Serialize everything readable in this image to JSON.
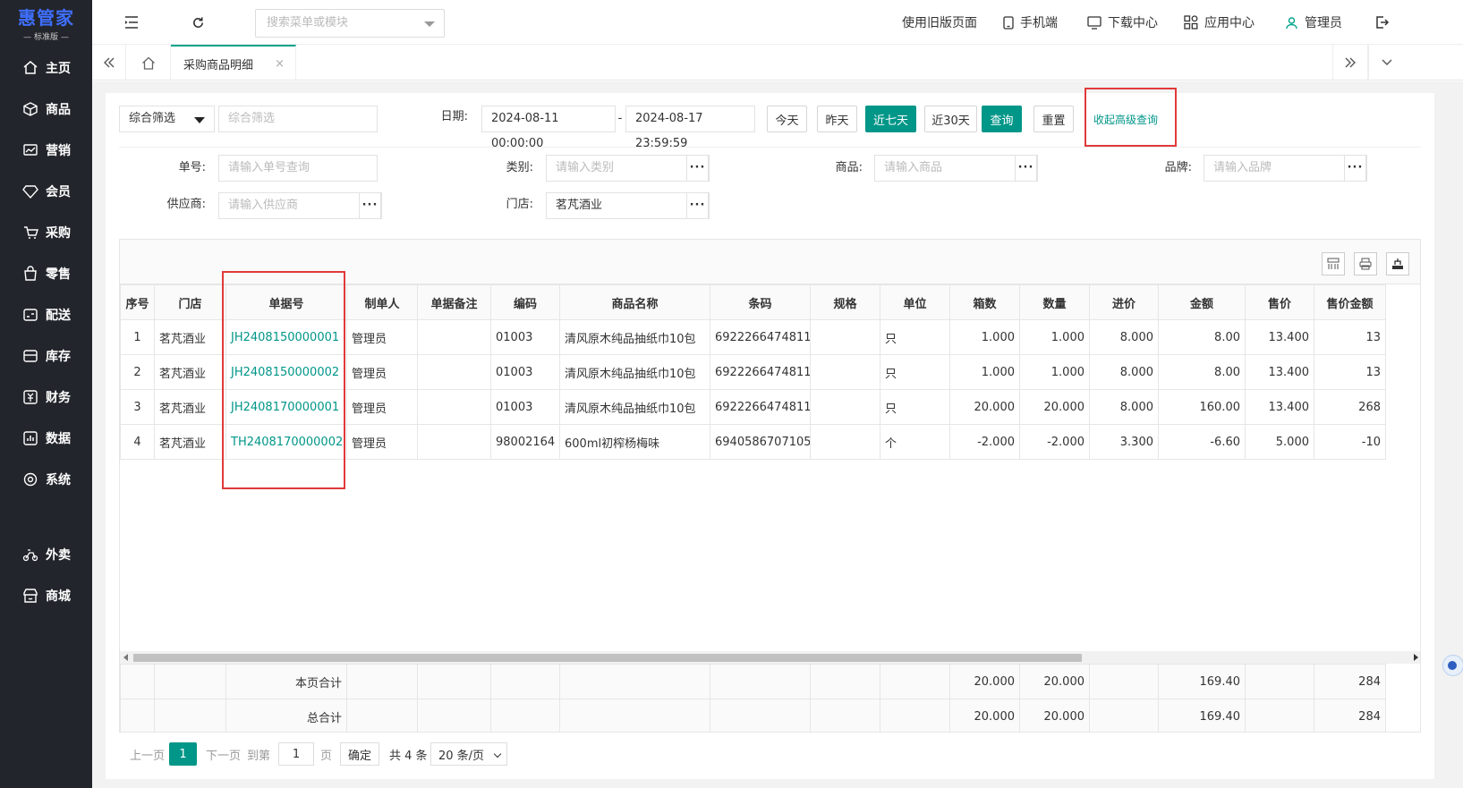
{
  "logo": {
    "main": "惠管家",
    "sub": "— 标准版 —"
  },
  "sidebar": {
    "items": [
      {
        "label": "主页",
        "icon": "home-icon"
      },
      {
        "label": "商品",
        "icon": "box-icon"
      },
      {
        "label": "营销",
        "icon": "chart-icon"
      },
      {
        "label": "会员",
        "icon": "diamond-icon"
      },
      {
        "label": "采购",
        "icon": "cart-icon"
      },
      {
        "label": "零售",
        "icon": "bag-icon"
      },
      {
        "label": "配送",
        "icon": "truck-icon"
      },
      {
        "label": "库存",
        "icon": "warehouse-icon"
      },
      {
        "label": "财务",
        "icon": "finance-icon"
      },
      {
        "label": "数据",
        "icon": "data-icon"
      },
      {
        "label": "系统",
        "icon": "settings-icon"
      },
      {
        "label": "外卖",
        "icon": "bike-icon"
      },
      {
        "label": "商城",
        "icon": "store-icon"
      }
    ]
  },
  "topbar": {
    "search_placeholder": "搜索菜单或模块",
    "old_version": "使用旧版页面",
    "mobile": "手机端",
    "download": "下载中心",
    "apps": "应用中心",
    "user": "管理员"
  },
  "tabs": {
    "active": "采购商品明细",
    "close": "×"
  },
  "filters": {
    "combo_select": "综合筛选",
    "combo_input_placeholder": "综合筛选",
    "date_label": "日期:",
    "date_start": "2024-08-11 00:00:00",
    "date_sep": "-",
    "date_end": "2024-08-17 23:59:59",
    "btn_today": "今天",
    "btn_yesterday": "昨天",
    "btn_7days": "近七天",
    "btn_30days": "近30天",
    "btn_query": "查询",
    "btn_reset": "重置",
    "advanced": "收起高级查询",
    "order_label": "单号:",
    "order_placeholder": "请输入单号查询",
    "category_label": "类别:",
    "category_placeholder": "请输入类别",
    "product_label": "商品:",
    "product_placeholder": "请输入商品",
    "brand_label": "品牌:",
    "brand_placeholder": "请输入品牌",
    "supplier_label": "供应商:",
    "supplier_placeholder": "请输入供应商",
    "store_label": "门店:",
    "store_value": "茗芃酒业",
    "dots": "···"
  },
  "table": {
    "headers": [
      "序号",
      "门店",
      "单据号",
      "制单人",
      "单据备注",
      "编码",
      "商品名称",
      "条码",
      "规格",
      "单位",
      "箱数",
      "数量",
      "进价",
      "金额",
      "售价",
      "售价金额"
    ],
    "rows": [
      [
        "1",
        "茗芃酒业",
        "JH2408150000001",
        "管理员",
        "",
        "01003",
        "清风原木纯品抽纸巾10包",
        "6922266474811",
        "",
        "只",
        "1.000",
        "1.000",
        "8.000",
        "8.00",
        "13.400",
        "13"
      ],
      [
        "2",
        "茗芃酒业",
        "JH2408150000002",
        "管理员",
        "",
        "01003",
        "清风原木纯品抽纸巾10包",
        "6922266474811",
        "",
        "只",
        "1.000",
        "1.000",
        "8.000",
        "8.00",
        "13.400",
        "13"
      ],
      [
        "3",
        "茗芃酒业",
        "JH2408170000001",
        "管理员",
        "",
        "01003",
        "清风原木纯品抽纸巾10包",
        "6922266474811",
        "",
        "只",
        "20.000",
        "20.000",
        "8.000",
        "160.00",
        "13.400",
        "268"
      ],
      [
        "4",
        "茗芃酒业",
        "TH2408170000002",
        "管理员",
        "",
        "98002164",
        "600ml初榨杨梅味",
        "6940586707105",
        "",
        "个",
        "-2.000",
        "-2.000",
        "3.300",
        "-6.60",
        "5.000",
        "-10"
      ]
    ],
    "page_total": {
      "label": "本页合计",
      "boxes": "20.000",
      "qty": "20.000",
      "amount": "169.40",
      "sale_amount": "284"
    },
    "grand_total": {
      "label": "总合计",
      "boxes": "20.000",
      "qty": "20.000",
      "amount": "169.40",
      "sale_amount": "284"
    }
  },
  "pager": {
    "prev": "上一页",
    "current": "1",
    "next": "下一页",
    "goto": "到第",
    "page_input": "1",
    "page_unit": "页",
    "confirm": "确定",
    "total": "共 4 条",
    "page_size": "20 条/页"
  },
  "colors": {
    "accent": "#009688",
    "sidebar": "#22252b",
    "highlight": "#e03a3a"
  }
}
